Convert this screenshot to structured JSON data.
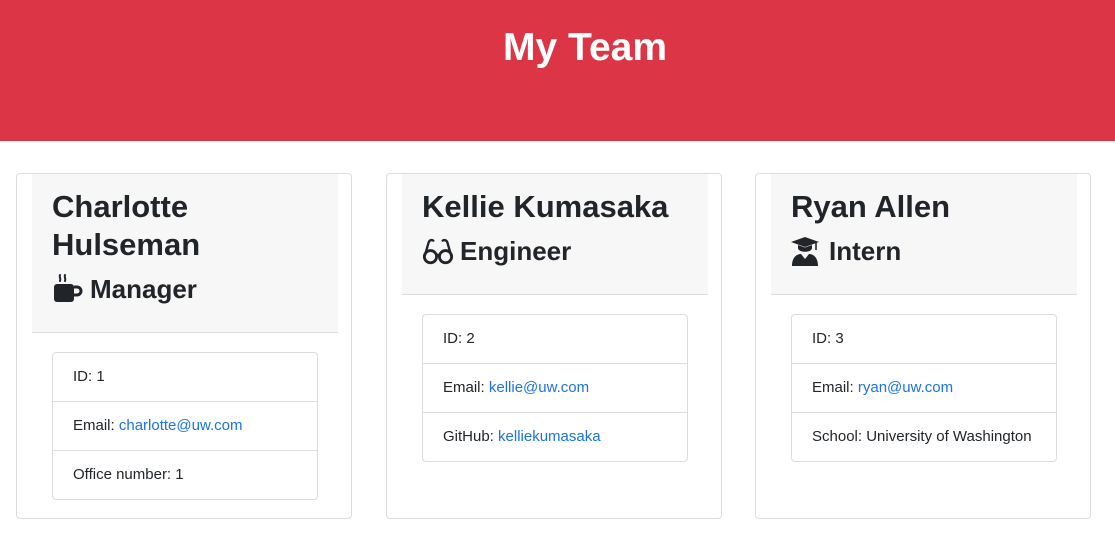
{
  "header": {
    "title": "My Team"
  },
  "team": [
    {
      "name": "Charlotte Hulseman",
      "role": "Manager",
      "role_icon": "mug-icon",
      "id_label": "ID:",
      "id": "1",
      "email_label": "Email:",
      "email": "charlotte@uw.com",
      "extra_label": "Office number:",
      "extra_value": "1"
    },
    {
      "name": "Kellie Kumasaka",
      "role": "Engineer",
      "role_icon": "glasses-icon",
      "id_label": "ID:",
      "id": "2",
      "email_label": "Email:",
      "email": "kellie@uw.com",
      "extra_label": "GitHub:",
      "extra_value": "kelliekumasaka"
    },
    {
      "name": "Ryan Allen",
      "role": "Intern",
      "role_icon": "graduate-icon",
      "id_label": "ID:",
      "id": "3",
      "email_label": "Email:",
      "email": "ryan@uw.com",
      "extra_label": "School:",
      "extra_value": "University of Washington"
    }
  ],
  "colors": {
    "banner": "#dc3545",
    "link": "#1a73e8",
    "header_bg": "#f7f7f7"
  }
}
